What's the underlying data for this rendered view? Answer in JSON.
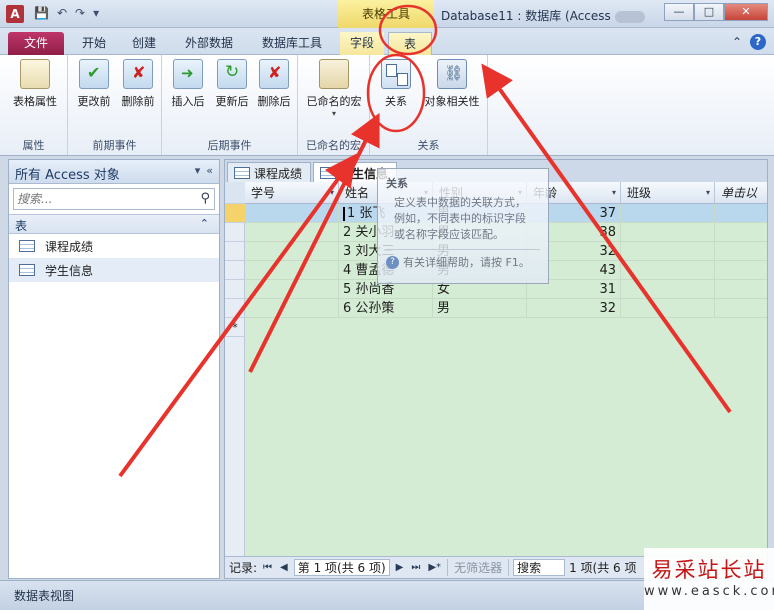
{
  "titlebar": {
    "app_icon_letter": "A",
    "qat_save": "💾",
    "qat_undo": "↶",
    "qat_redo": "↷",
    "qat_customize": "▾",
    "context_header": "表格工具",
    "window_title": "Database11 : 数据库 (Access",
    "minimize": "—",
    "maximize": "□",
    "close": "✕"
  },
  "tabs": {
    "file": "文件",
    "home": "开始",
    "create": "创建",
    "external": "外部数据",
    "dbtools": "数据库工具",
    "fields": "字段",
    "table": "表",
    "collapse": "⌃",
    "help": "?"
  },
  "ribbon": {
    "groups": {
      "properties": "属性",
      "before_events": "前期事件",
      "after_events": "后期事件",
      "named_macros": "已命名的宏",
      "relationships": "关系"
    },
    "buttons": {
      "table_properties": "表格属性",
      "before_change": "更改前",
      "before_delete": "删除前",
      "after_insert": "插入后",
      "after_update": "更新后",
      "after_delete": "删除后",
      "named_macro": "已命名的宏",
      "relationships": "关系",
      "object_dependencies": "对象相关性"
    }
  },
  "nav": {
    "header": "所有 Access 对象",
    "header_dropdown": "▾",
    "header_close": "«",
    "search_placeholder": "搜索...",
    "search_icon": "⚲",
    "group_label": "表",
    "group_collapse": "⌃",
    "items": [
      {
        "label": "课程成绩"
      },
      {
        "label": "学生信息"
      }
    ]
  },
  "doc": {
    "tabs": [
      {
        "label": "课程成绩"
      },
      {
        "label": "学生信息"
      }
    ],
    "columns": [
      "学号",
      "姓名",
      "性别",
      "年龄",
      "班级",
      "单击以"
    ],
    "rows": [
      {
        "id": "1",
        "name": "张飞",
        "gender": "男",
        "age": "37"
      },
      {
        "id": "2",
        "name": "关小羽",
        "gender": "男",
        "age": "38"
      },
      {
        "id": "3",
        "name": "刘大三",
        "gender": "男",
        "age": "32"
      },
      {
        "id": "4",
        "name": "曹孟德",
        "gender": "男",
        "age": "43"
      },
      {
        "id": "5",
        "name": "孙尚香",
        "gender": "女",
        "age": "31"
      },
      {
        "id": "6",
        "name": "公孙策",
        "gender": "男",
        "age": "32"
      }
    ],
    "new_row_marker": "*"
  },
  "tooltip": {
    "title": "关系",
    "body_line1": "定义表中数据的关联方式，",
    "body_line2": "例如，不同表中的标识字段",
    "body_line3": "或名称字段应该匹配。",
    "help_text": "有关详细帮助，请按 F1。"
  },
  "recnav": {
    "label": "记录:",
    "first": "⏮",
    "prev": "◀",
    "position": "第 1 项(共 6 项)",
    "next": "▶",
    "last": "⏭",
    "new": "▶*",
    "filter": "无筛选器",
    "search": "搜索",
    "trailing": "1 项(共 6 项"
  },
  "status": {
    "view": "数据表视图"
  },
  "watermark": {
    "title": "易采站长站",
    "url": "www.easck.com"
  },
  "colors": {
    "file_tab": "#a52a52",
    "context_tab": "#f0d86a",
    "annotation": "#e8332c",
    "grid_bg": "#d4ecd4",
    "current_row": "#b9d8ee"
  }
}
